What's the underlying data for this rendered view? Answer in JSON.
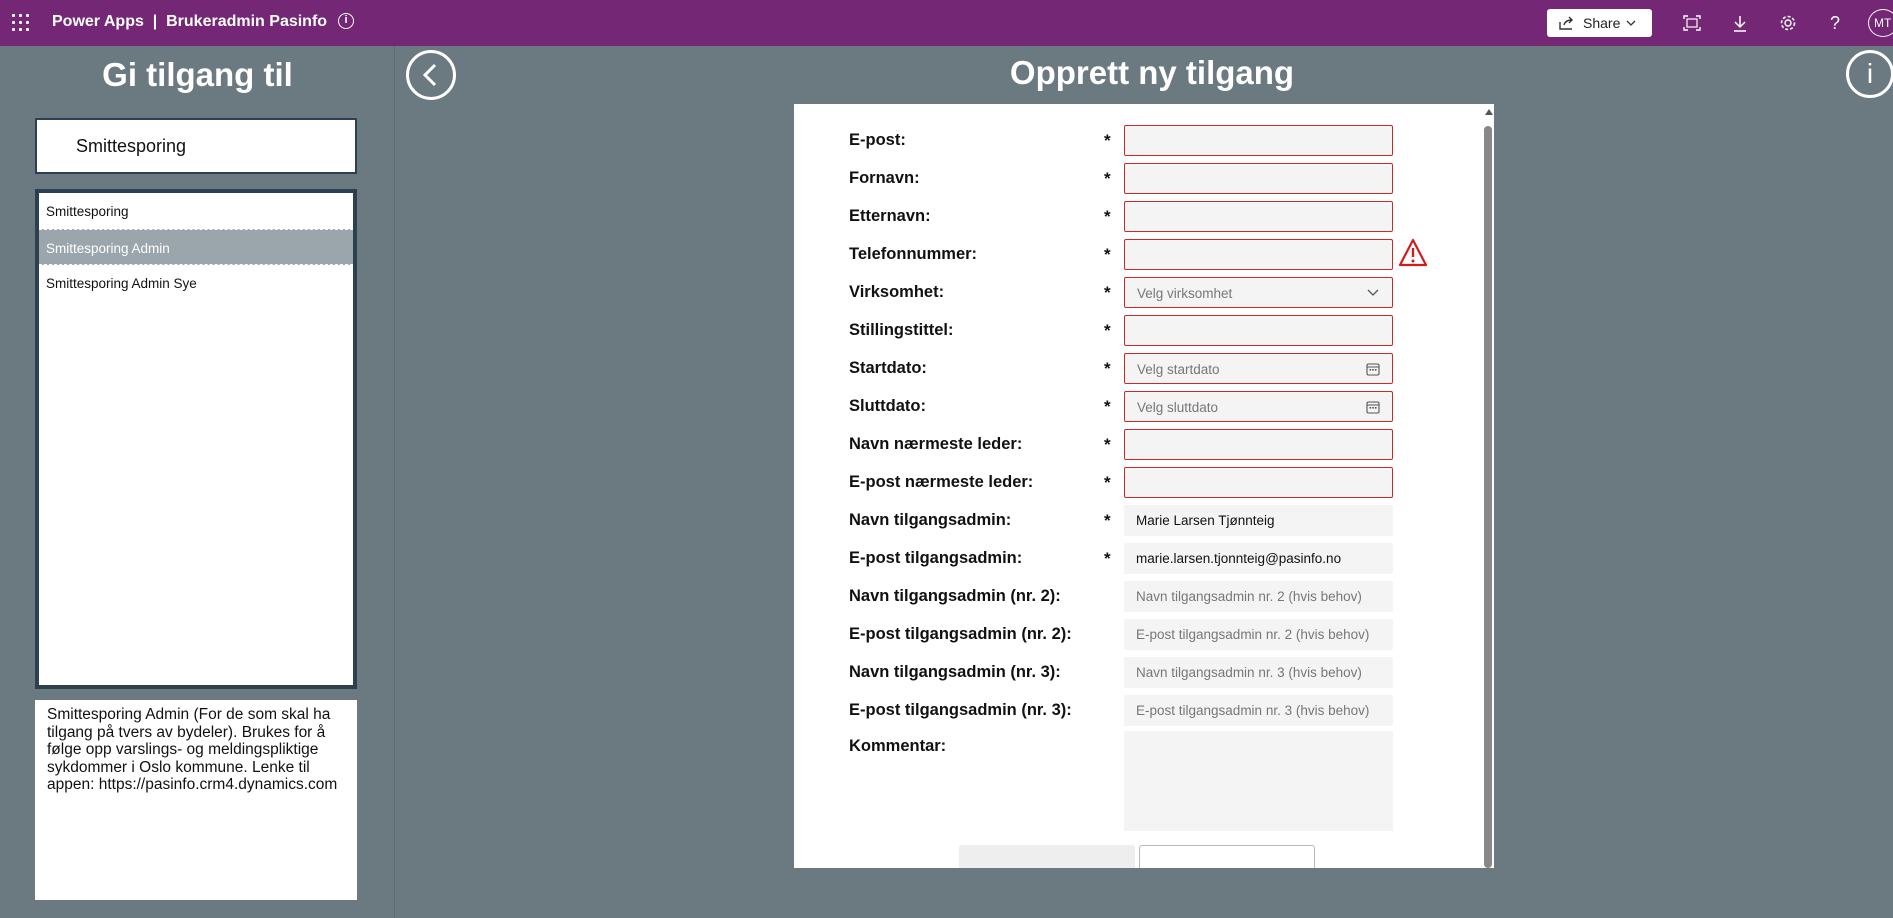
{
  "topbar": {
    "app_name": "Power Apps  |  Brukeradmin Pasinfo",
    "share_label": "Share",
    "avatar_initials": "MT",
    "icons": [
      "waffle-icon",
      "info-icon",
      "share-icon",
      "fit-screen-icon",
      "download-icon",
      "settings-icon",
      "help-icon"
    ]
  },
  "left": {
    "title": "Gi tilgang til",
    "search_value": "Smittesporing",
    "list_items": [
      "Smittesporing",
      "Smittesporing Admin",
      "Smittesporing Admin Sye"
    ],
    "selected_index": 1,
    "description": "Smittesporing Admin (For de som skal ha tilgang på tvers av bydeler). Brukes for å følge opp varslings- og meldingspliktige sykdommer i Oslo kommune. Lenke til appen: https://pasinfo.crm4.dynamics.com"
  },
  "main": {
    "title": "Opprett ny tilgang",
    "info_label": "i"
  },
  "form": {
    "fields": [
      {
        "label": "E-post:",
        "required": "*",
        "value": "",
        "placeholder": ""
      },
      {
        "label": "Fornavn:",
        "required": "*",
        "value": "",
        "placeholder": ""
      },
      {
        "label": "Etternavn:",
        "required": "*",
        "value": "",
        "placeholder": ""
      },
      {
        "label": "Telefonnummer:",
        "required": "*",
        "value": "",
        "placeholder": ""
      },
      {
        "label": "Virksomhet:",
        "required": "*",
        "value": "",
        "placeholder": "Velg virksomhet"
      },
      {
        "label": "Stillingstittel:",
        "required": "*",
        "value": "",
        "placeholder": ""
      },
      {
        "label": "Startdato:",
        "required": "*",
        "value": "",
        "placeholder": "Velg startdato"
      },
      {
        "label": "Sluttdato:",
        "required": "*",
        "value": "",
        "placeholder": "Velg sluttdato"
      },
      {
        "label": "Navn nærmeste leder:",
        "required": "*",
        "value": "",
        "placeholder": ""
      },
      {
        "label": "E-post nærmeste leder:",
        "required": "*",
        "value": "",
        "placeholder": ""
      },
      {
        "label": "Navn tilgangsadmin:",
        "required": "*",
        "value": "Marie Larsen Tjønnteig",
        "placeholder": ""
      },
      {
        "label": "E-post tilgangsadmin:",
        "required": "*",
        "value": "marie.larsen.tjonnteig@pasinfo.no",
        "placeholder": ""
      },
      {
        "label": "Navn tilgangsadmin (nr. 2):",
        "required": "",
        "value": "",
        "placeholder": "Navn tilgangsadmin nr. 2 (hvis behov)"
      },
      {
        "label": "E-post tilgangsadmin (nr. 2):",
        "required": "",
        "value": "",
        "placeholder": "E-post tilgangsadmin nr. 2 (hvis behov)"
      },
      {
        "label": "Navn tilgangsadmin (nr. 3):",
        "required": "",
        "value": "",
        "placeholder": "Navn tilgangsadmin nr. 3 (hvis behov)"
      },
      {
        "label": "E-post tilgangsadmin (nr. 3):",
        "required": "",
        "value": "",
        "placeholder": "E-post tilgangsadmin nr. 3 (hvis behov)"
      }
    ],
    "comment_label": "Kommentar:",
    "comment_value": "",
    "warning_field": "Telefonnummer:"
  },
  "colors": {
    "topbar": "#742774",
    "background": "#6b7a80",
    "list_border": "#2d4050",
    "selected_item": "#9aa6ab",
    "error_border": "#cc2a2a"
  }
}
